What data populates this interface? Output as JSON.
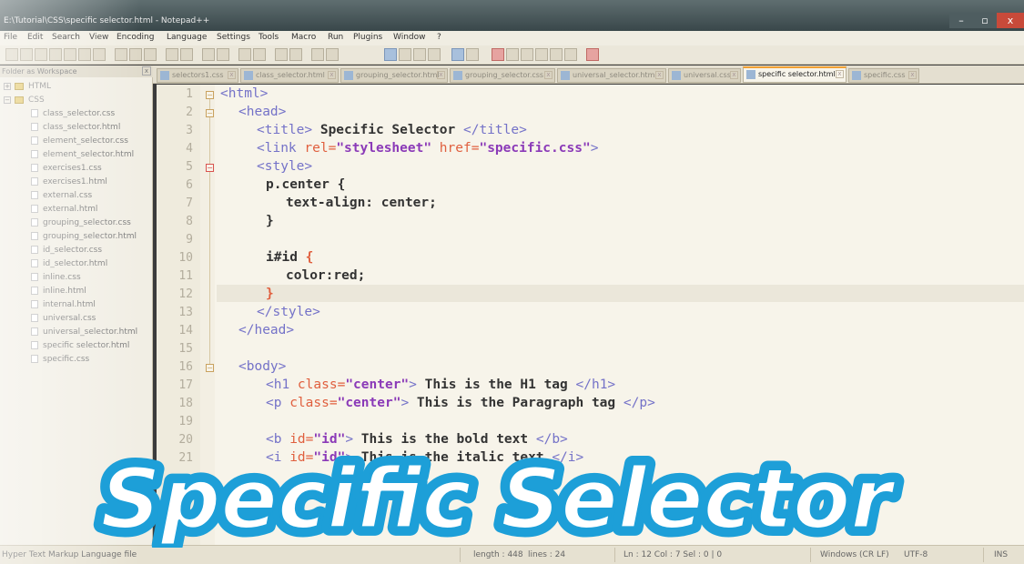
{
  "window": {
    "title": "E:\\Tutorial\\CSS\\specific selector.html - Notepad++",
    "minimize_glyph": "–",
    "maximize_glyph": "▫",
    "close_glyph": "x"
  },
  "menu": [
    "File",
    "Edit",
    "Search",
    "View",
    "Encoding",
    "Language",
    "Settings",
    "Tools",
    "Macro",
    "Run",
    "Plugins",
    "Window",
    "?"
  ],
  "tabs": [
    {
      "label": "selectors1.css",
      "active": false
    },
    {
      "label": "class_selector.html",
      "active": false
    },
    {
      "label": "grouping_selector.html",
      "active": false
    },
    {
      "label": "grouping_selector.css",
      "active": false
    },
    {
      "label": "universal_selector.html",
      "active": false
    },
    {
      "label": "universal.css",
      "active": false
    },
    {
      "label": "specific selector.html",
      "active": true
    },
    {
      "label": "specific.css",
      "active": false
    }
  ],
  "workspace": {
    "header": "Folder as Workspace",
    "close_glyph": "x",
    "folders": [
      {
        "label": "HTML",
        "expander": "+"
      },
      {
        "label": "CSS",
        "expander": "−"
      }
    ],
    "files": [
      "class_selector.css",
      "class_selector.html",
      "element_selector.css",
      "element_selector.html",
      "exercises1.css",
      "exercises1.html",
      "external.css",
      "external.html",
      "grouping_selector.css",
      "grouping_selector.html",
      "id_selector.css",
      "id_selector.html",
      "inline.css",
      "inline.html",
      "internal.html",
      "universal.css",
      "universal_selector.html",
      "specific selector.html",
      "specific.css"
    ]
  },
  "editor": {
    "line_numbers": [
      "1",
      "2",
      "3",
      "4",
      "5",
      "6",
      "7",
      "8",
      "9",
      "10",
      "11",
      "12",
      "13",
      "14",
      "15",
      "16",
      "17",
      "18",
      "19",
      "20",
      "21"
    ],
    "fold_glyph": "−",
    "code": {
      "l1_tag": "<html>",
      "l2_tag": "<head>",
      "l3_open": "<title>",
      "l3_text": " Specific Selector ",
      "l3_close": "</title>",
      "l4_open": "<link ",
      "l4_attr1": "rel=",
      "l4_val1": "\"stylesheet\"",
      "l4_attr2": " href=",
      "l4_val2": "\"specific.css\"",
      "l4_close": ">",
      "l5_tag": "<style>",
      "l6_sel": "p.center ",
      "l6_brace": "{",
      "l7_prop": "text-align: center;",
      "l8_brace": "}",
      "l10_sel": "i#id ",
      "l10_brace": "{",
      "l11_prop": "color:red;",
      "l12_brace": "}",
      "l13_tag": "</style>",
      "l14_tag": "</head>",
      "l16_tag": "<body>",
      "l17_open": "<h1 ",
      "l17_attr": "class=",
      "l17_val": "\"center\"",
      "l17_gt": ">",
      "l17_text": " This is the H1 tag ",
      "l17_close": "</h1>",
      "l18_open": "<p ",
      "l18_attr": "class=",
      "l18_val": "\"center\"",
      "l18_gt": ">",
      "l18_text": " This is the Paragraph tag ",
      "l18_close": "</p>",
      "l20_open": "<b ",
      "l20_attr": "id=",
      "l20_val": "\"id\"",
      "l20_gt": ">",
      "l20_text": " This is the bold text ",
      "l20_close": "</b>",
      "l21_open": "<i ",
      "l21_attr": "id=",
      "l21_val": "\"id\"",
      "l21_gt": ">",
      "l21_text": " This is the italic text ",
      "l21_close": "</i>"
    }
  },
  "status": {
    "file_type": "Hyper Text Markup Language file",
    "length": "length : 448",
    "lines": "lines : 24",
    "position": "Ln : 12    Col : 7    Sel : 0 | 0",
    "eol": "Windows (CR LF)",
    "encoding": "UTF-8",
    "mode": "INS"
  },
  "overlay": {
    "text": "Specific Selector",
    "fill_color": "#ffffff",
    "outline_color": "#1d9fd8"
  }
}
